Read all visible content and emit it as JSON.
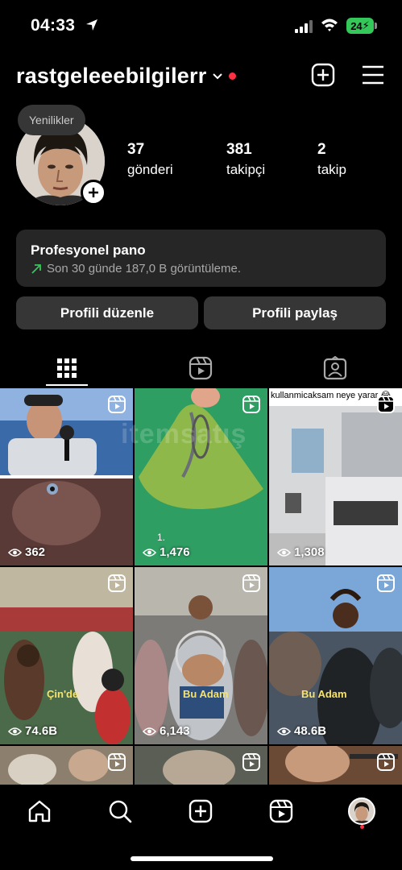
{
  "status": {
    "time": "04:33",
    "battery": "24"
  },
  "profile": {
    "username": "rastgeleeebilgilerr",
    "notes_bubble": "Yenilikler",
    "stats": [
      {
        "num": "37",
        "label": "gönderi"
      },
      {
        "num": "381",
        "label": "takipçi"
      },
      {
        "num": "2",
        "label": "takip"
      }
    ]
  },
  "pro_dashboard": {
    "title": "Profesyonel pano",
    "subtitle": "Son 30 günde 187,0 B görüntüleme."
  },
  "buttons": {
    "edit": "Profili düzenle",
    "share": "Profili paylaş"
  },
  "tabs": [
    "grid-icon",
    "reels-icon",
    "tagged-icon"
  ],
  "grid": [
    {
      "views": "362",
      "caption": ""
    },
    {
      "views": "1,476",
      "caption": "1."
    },
    {
      "views": "1,308",
      "caption": "kullanmicaksam neye yarar 😂"
    },
    {
      "views": "74.6B",
      "caption": "Çin'de"
    },
    {
      "views": "6,143",
      "caption": "Bu Adam"
    },
    {
      "views": "48.6B",
      "caption": "Bu Adam"
    },
    {
      "views": "",
      "caption": ""
    },
    {
      "views": "",
      "caption": ""
    },
    {
      "views": "",
      "caption": ""
    }
  ],
  "watermark": "itemsatış",
  "nav": [
    "home-icon",
    "search-icon",
    "create-icon",
    "reels-icon",
    "profile-avatar"
  ],
  "colors": {
    "accent_red": "#ff3040",
    "battery_green": "#34c759",
    "card_bg": "#262626",
    "button_bg": "#363636"
  }
}
